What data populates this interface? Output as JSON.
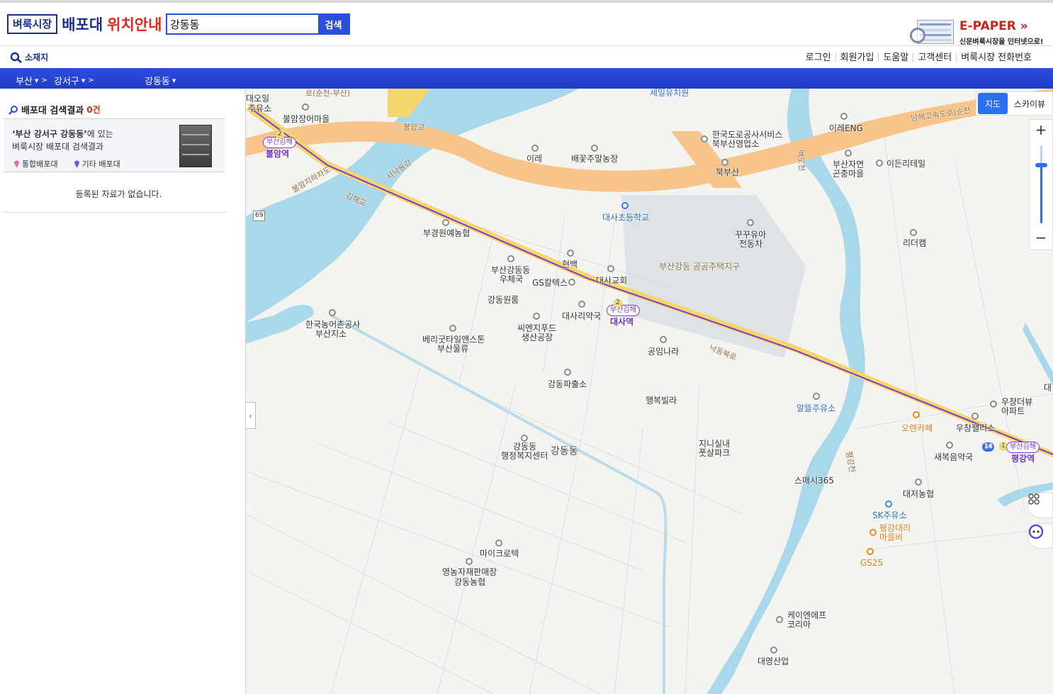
{
  "header": {
    "logo_box": "벼룩시장",
    "logo_title1": "배포대",
    "logo_title2": "위치안내",
    "search_value": "강동동",
    "search_button": "검색",
    "epaper_title": "E-PAPER »",
    "epaper_sub": "신문벼룩시장을 인터넷으로!"
  },
  "subbar": {
    "sojaeji": "소재지",
    "links": [
      "로그인",
      "회원가입",
      "도움말",
      "고객센터",
      "벼룩시장 전화번호"
    ]
  },
  "nav": {
    "items": [
      {
        "label": "부산"
      },
      {
        "label": "강서구"
      },
      {
        "label": "강동동"
      }
    ]
  },
  "sidebar": {
    "result_title": "배포대 검색결과",
    "result_count": "0건",
    "info_quote": "‘부산 강서구 강동동’",
    "info_suffix": "에 있는",
    "info_line2": "벼룩시장 배포대 검색결과",
    "legend_integrated": "통합배포대",
    "legend_other": "기타 배포대",
    "empty_message": "등록된 자료가 없습니다."
  },
  "map": {
    "type_map": "지도",
    "type_sky": "스카이뷰",
    "zoom_in": "+",
    "zoom_out": "−",
    "labels": {
      "l_daeoil": "대오일",
      "l_juyuso1": "주유소",
      "l_bulamjang": "불암장어마을",
      "l_bulamyeok": "불암역",
      "l_ire": "이레",
      "l_baekkot": "배꽃주말농장",
      "l_hangukdoro1": "한국도로공사서비스",
      "l_hangukdoro2": "북부산영업소",
      "l_bukbusan": "북부산",
      "l_ireeng": "이레ENG",
      "l_busanjayeon1": "부산자연",
      "l_busanjayeon2": "곤충마을",
      "l_idiri": "이든리테일",
      "l_namhae": "남해고속도로(순천",
      "l_road_left": "로(순천-부산)",
      "l_bulamgyo": "불암교",
      "l_seonakdong": "서낙동강",
      "l_bulamjihacha": "불암지하차도",
      "l_gimhaegyo": "김해교",
      "l_69": "69",
      "l_daesa_school": "대사초등학교",
      "l_kkukku1": "꾸꾸유아",
      "l_kkukku2": "전동차",
      "l_ridu": "리더캠",
      "l_bugyeong": "부경원예농협",
      "l_busangangdong1": "부산강동동",
      "l_busangangdong2": "우체국",
      "l_hyeonbaek": "현백",
      "l_daesa_church": "대사교회",
      "l_gangdong_zone": "부산강동 공공주택지구",
      "l_gscaltex": "GS칼텍스",
      "l_gangdongwon": "강동원룸",
      "l_daesari": "대사리약국",
      "l_daesa_st": "대사역",
      "l_hangeonong1": "한국농어촌공사",
      "l_hangeonong2": "부산지소",
      "l_ssienji1": "씨엔지푸드",
      "l_ssienji2": "생산공장",
      "l_berrigut1": "베리굿타일앤스톤",
      "l_berrigut2": "부산물류",
      "l_gongim": "공임나라",
      "l_nakdongbukro": "낙동북로",
      "l_gangdong_police": "강동파출소",
      "l_haengbok": "행복빌라",
      "l_altteul": "알뜰주유소",
      "l_orencafe": "오렌카페",
      "l_uchangdeo1": "우창더뷰",
      "l_uchangdeo2": "아파트",
      "l_uchangpal": "우창팰리스",
      "l_saebok": "새복음약국",
      "l_pyeonggang_st": "평강역",
      "l_gangdong_center1": "강동동",
      "l_gangdong_center2": "행정복지센터",
      "l_gangdong_area": "강동동",
      "l_jini1": "지니실내",
      "l_jini2": "풋살파크",
      "l_smasi": "스매시365",
      "l_daejeo": "대저농협",
      "l_sk": "SK주유소",
      "l_pyeonggangdaeri1": "평강대리",
      "l_pyeonggangdaeri2": "마을비",
      "l_gs25": "GS25",
      "l_micro": "마이크로텍",
      "l_yeongnong1": "영농자재판매장",
      "l_yeongnong2": "강동농협",
      "l_keien1": "케이엔에프",
      "l_keien2": "코리아",
      "l_daeyeong": "대영산업",
      "l_pyeonggangcheon": "평강천",
      "l_maecheon": "맥도천",
      "l_dae_right": "대",
      "l_top_mid": "세일유치원",
      "l_stn_busan_gimhae": "부산김해",
      "l_route2": "2",
      "l_route14": "14",
      "l_route1": "1"
    }
  },
  "colors": {
    "brand_navy": "#1a2f8c",
    "brand_red": "#e3261b",
    "nav_blue": "#2e4de0",
    "map_water": "#a8d8ea",
    "map_highway": "#f7c58b",
    "map_rail": "#7b3bd6",
    "map_type_active": "#2a6ff0"
  },
  "icons": {
    "sojaeji": "location-r-icon",
    "search_result": "magnifier-icon",
    "integrated_pin": "pink-pin-icon",
    "other_pin": "purple-pin-icon",
    "collapse": "chevron-left-icon",
    "tool1": "grid-icon",
    "tool2": "face-icon"
  }
}
